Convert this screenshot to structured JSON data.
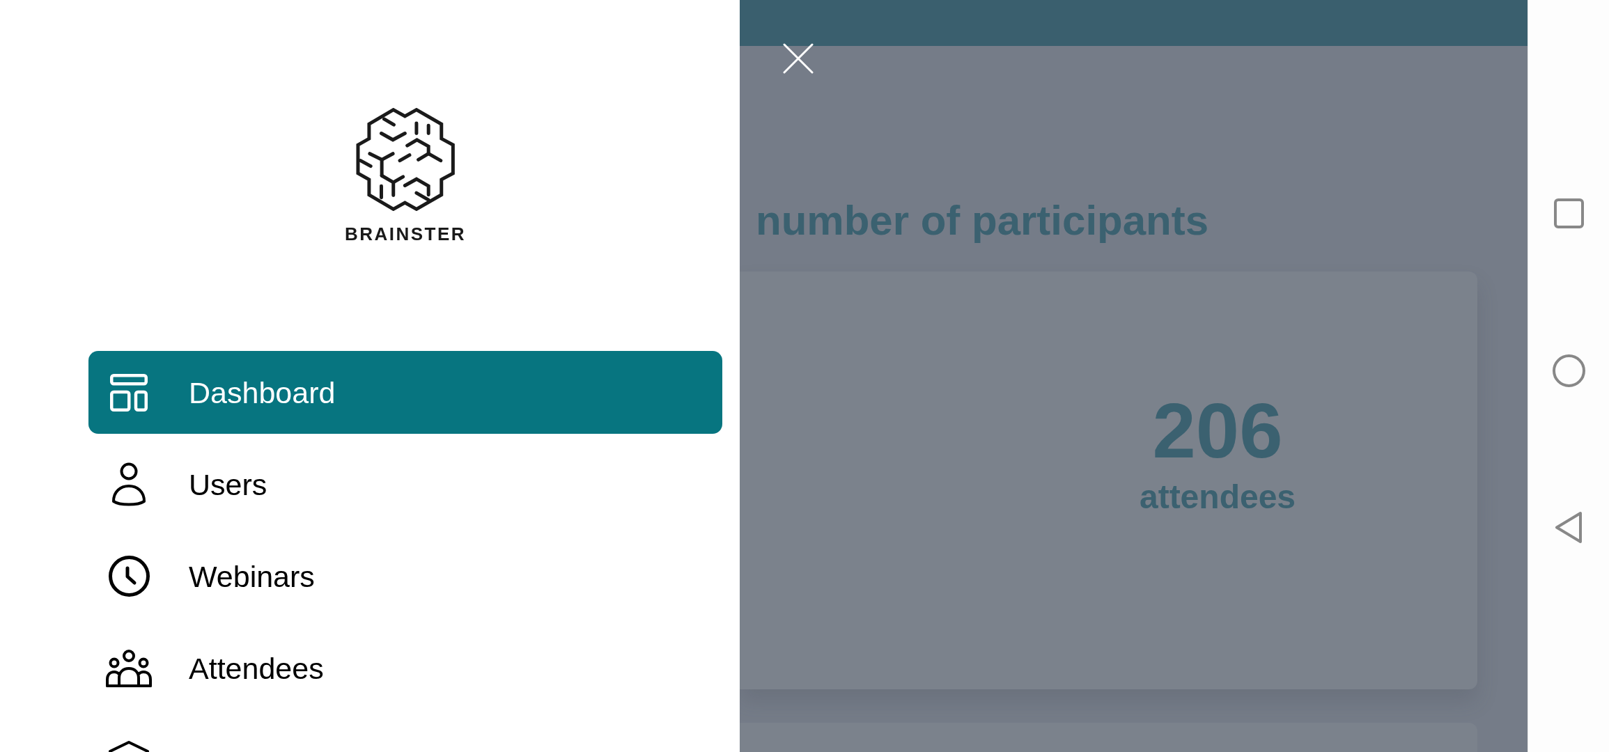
{
  "drawer": {
    "brand": "BRAINSTER",
    "items": [
      {
        "label": "Dashboard",
        "selected": true
      },
      {
        "label": "Users",
        "selected": false
      },
      {
        "label": "Webinars",
        "selected": false
      },
      {
        "label": "Attendees",
        "selected": false
      },
      {
        "selected": false
      }
    ]
  },
  "dashboard": {
    "heading": "number of participants",
    "stat": {
      "value": "206",
      "caption": "attendees"
    }
  }
}
